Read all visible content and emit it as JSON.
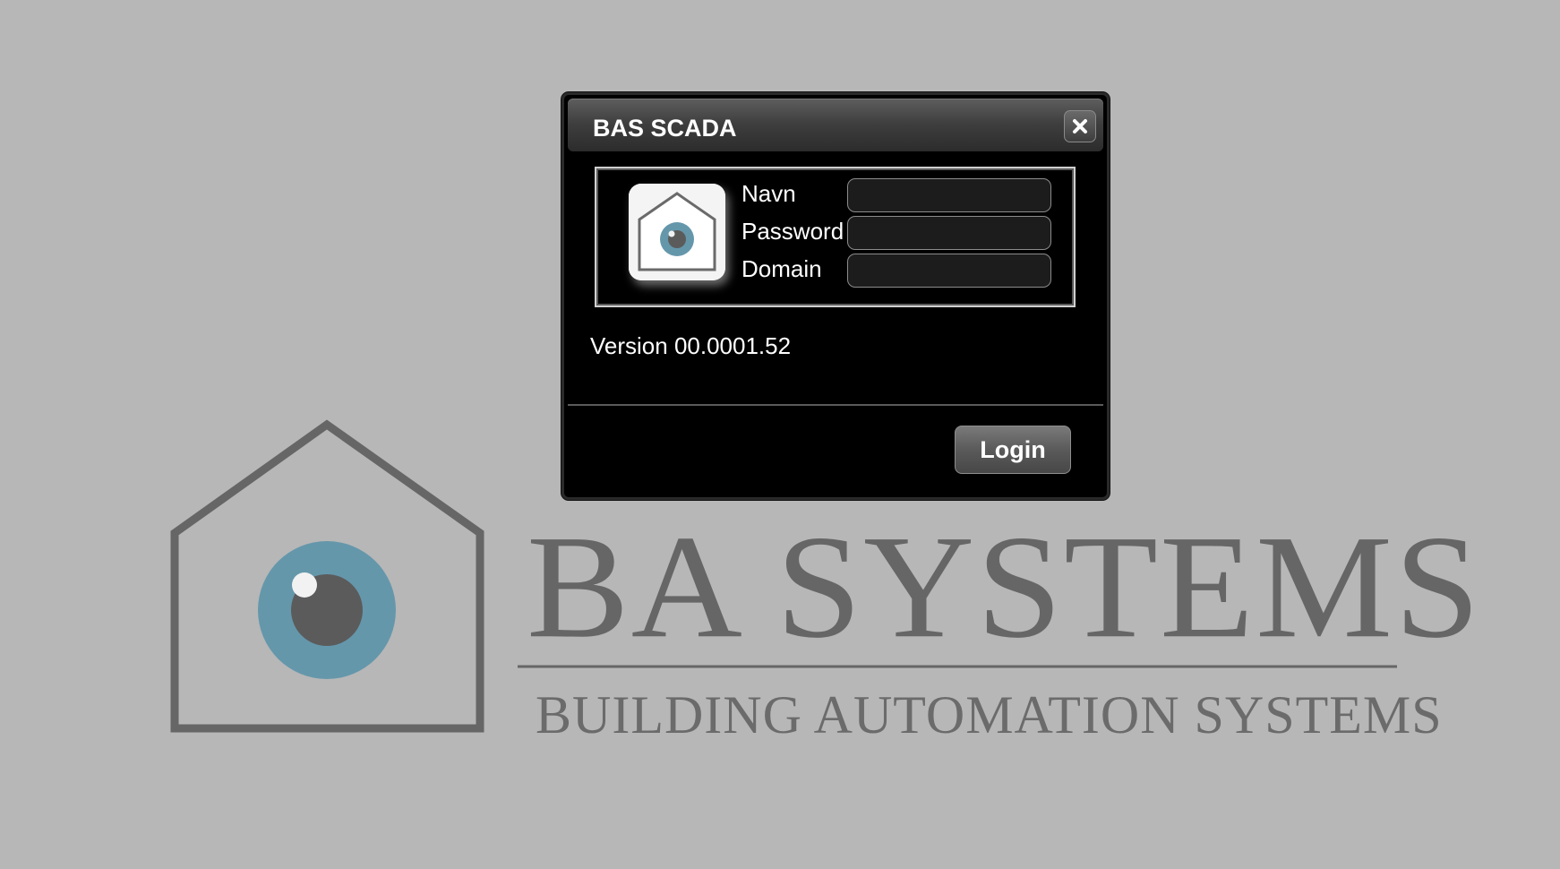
{
  "dialog": {
    "title": "BAS SCADA",
    "close_icon": "close-icon",
    "fields": [
      {
        "label": "Navn",
        "value": "",
        "placeholder": ""
      },
      {
        "label": "Password",
        "value": "",
        "placeholder": ""
      },
      {
        "label": "Domain",
        "value": "",
        "placeholder": ""
      }
    ],
    "version": "Version 00.0001.52",
    "login_label": "Login",
    "app_icon": "house-eye-icon"
  },
  "background": {
    "logo_icon": "house-eye-logo-icon",
    "wordmark": "BA SYSTEMS",
    "tagline": "BUILDING AUTOMATION SYSTEMS"
  },
  "colors": {
    "page_background": "#b7b7b7",
    "logo_gray": "#666666",
    "eye_iris": "#6597ab",
    "eye_pupil": "#5b5b5b",
    "dialog_background": "#000000"
  }
}
